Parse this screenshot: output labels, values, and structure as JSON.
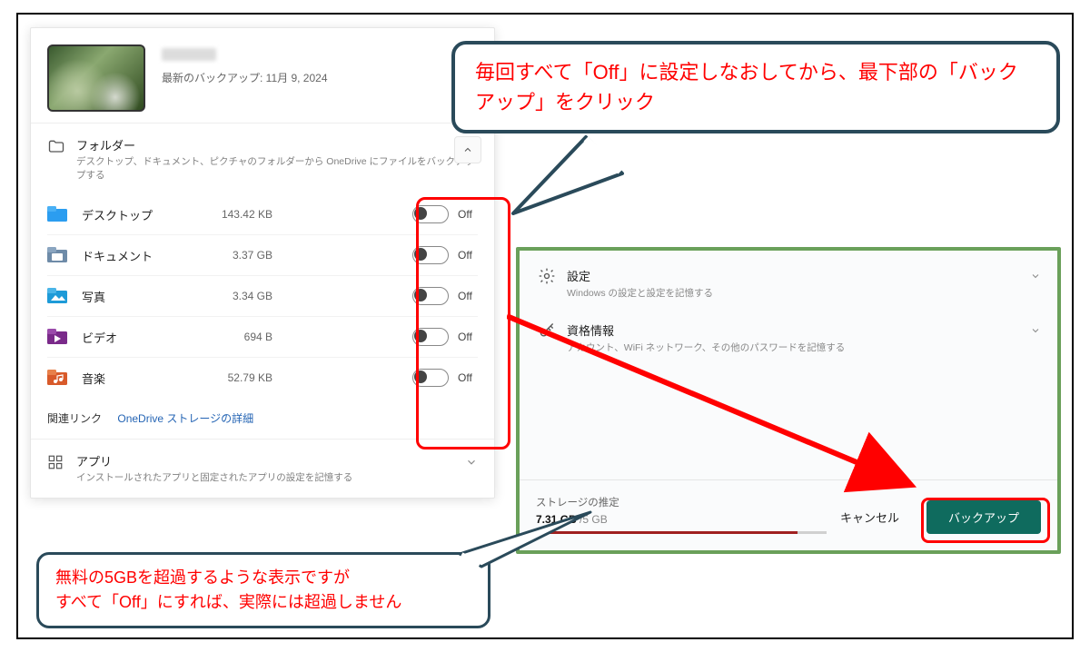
{
  "device": {
    "last_backup_label": "最新のバックアップ: 11月 9, 2024"
  },
  "folder_section": {
    "title": "フォルダー",
    "subtitle": "デスクトップ、ドキュメント、ピクチャのフォルダーから OneDrive にファイルをバックアップする"
  },
  "folders": [
    {
      "name": "デスクトップ",
      "size": "143.42 KB",
      "state": "Off",
      "icon": "#1e90ff"
    },
    {
      "name": "ドキュメント",
      "size": "3.37 GB",
      "state": "Off",
      "icon": "#6e8ba8"
    },
    {
      "name": "写真",
      "size": "3.34 GB",
      "state": "Off",
      "icon": "#1e9bd8"
    },
    {
      "name": "ビデオ",
      "size": "694 B",
      "state": "Off",
      "icon": "#7a2a8a"
    },
    {
      "name": "音楽",
      "size": "52.79 KB",
      "state": "Off",
      "icon": "#d85a2a"
    }
  ],
  "related": {
    "label": "関連リンク",
    "link": "OneDrive ストレージの詳細"
  },
  "apps": {
    "title": "アプリ",
    "subtitle": "インストールされたアプリと固定されたアプリの設定を記憶する"
  },
  "right_items": [
    {
      "title": "設定",
      "sub": "Windows の設定と設定を記憶する",
      "icon": "gear"
    },
    {
      "title": "資格情報",
      "sub": "アカウント、WiFi ネットワーク、その他のパスワードを記憶する",
      "icon": "key"
    }
  ],
  "storage": {
    "label": "ストレージの推定",
    "used": "7.31 GB",
    "total": "/5 GB"
  },
  "buttons": {
    "cancel": "キャンセル",
    "backup": "バックアップ"
  },
  "callout1": "毎回すべて「Off」に設定しなおしてから、最下部の「バックアップ」をクリック",
  "callout2": "無料の5GBを超過するような表示ですが\nすべて「Off」にすれば、実際には超過しません"
}
